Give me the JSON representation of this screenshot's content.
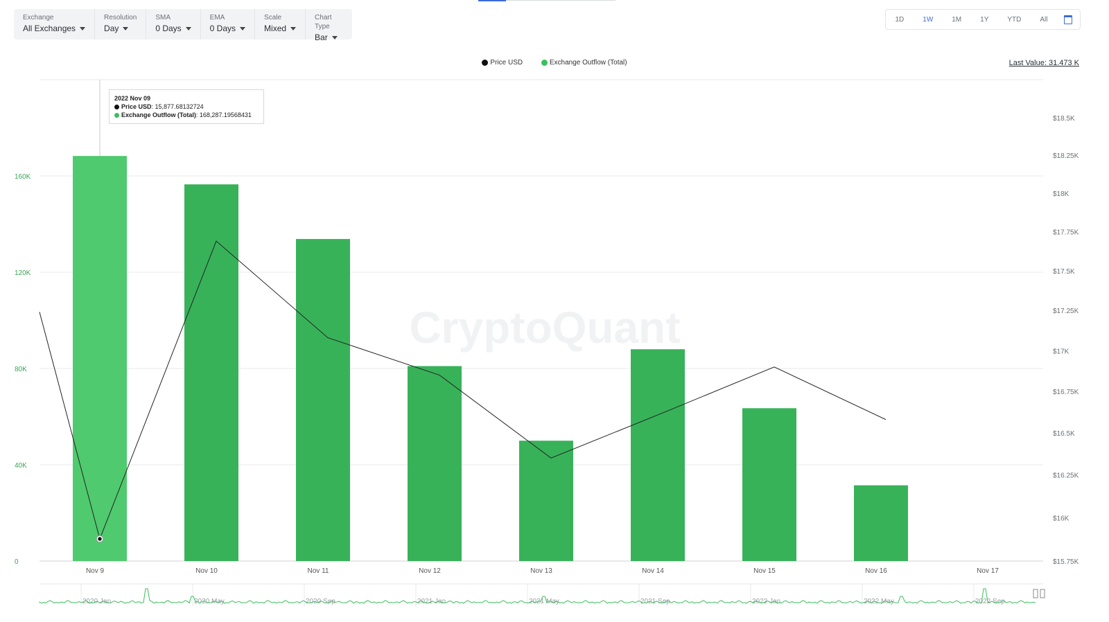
{
  "toolbar": {
    "exchange": {
      "label": "Exchange",
      "value": "All Exchanges"
    },
    "resolution": {
      "label": "Resolution",
      "value": "Day"
    },
    "sma": {
      "label": "SMA",
      "value": "0 Days"
    },
    "ema": {
      "label": "EMA",
      "value": "0 Days"
    },
    "scale": {
      "label": "Scale",
      "value": "Mixed"
    },
    "chart_type": {
      "label": "Chart Type",
      "value": "Bar"
    }
  },
  "range_buttons": [
    "1D",
    "1W",
    "1M",
    "1Y",
    "YTD",
    "All"
  ],
  "range_active": "1W",
  "legend": {
    "price": "Price USD",
    "outflow": "Exchange Outflow (Total)"
  },
  "last_value": "Last Value: 31.473 K",
  "watermark": "CryptoQuant",
  "tooltip": {
    "date": "2022 Nov 09",
    "price_label": "Price USD",
    "price_value": ": 15,877.68132724",
    "outflow_label": "Exchange Outflow (Total)",
    "outflow_value": ": 168,287.19568431"
  },
  "colors": {
    "bar": "#38b259",
    "bar_highlight": "#4fca6e",
    "line": "#222222",
    "left_axis": "#3aa655",
    "grid": "#e8e9eb"
  },
  "chart_data": {
    "type": "bar",
    "categories": [
      "Nov 9",
      "Nov 10",
      "Nov 11",
      "Nov 12",
      "Nov 13",
      "Nov 14",
      "Nov 15",
      "Nov 16",
      "Nov 17"
    ],
    "series": [
      {
        "name": "Exchange Outflow (Total)",
        "type": "bar",
        "axis": "left",
        "values": [
          168287,
          156500,
          133800,
          81000,
          50000,
          88000,
          63500,
          31473,
          null
        ]
      },
      {
        "name": "Price USD",
        "type": "line",
        "axis": "right",
        "x_start_value": 17240,
        "values": [
          15877,
          17690,
          17080,
          16850,
          16350,
          16620,
          16900,
          16580,
          null
        ]
      }
    ],
    "left_axis": {
      "ticks": [
        "0",
        "40K",
        "80K",
        "120K",
        "160K"
      ],
      "tick_values": [
        0,
        40000,
        80000,
        120000,
        160000
      ],
      "ylim": [
        0,
        200000
      ]
    },
    "right_axis": {
      "ticks": [
        "$15.75K",
        "$16K",
        "$16.25K",
        "$16.5K",
        "$16.75K",
        "$17K",
        "$17.25K",
        "$17.5K",
        "$17.75K",
        "$18K",
        "$18.25K",
        "$18.5K"
      ],
      "tick_values": [
        15750,
        16000,
        16250,
        16500,
        16750,
        17000,
        17250,
        17500,
        17750,
        18000,
        18250,
        18500
      ],
      "scale": "log"
    },
    "highlight_index": 0,
    "navigator_labels": [
      "2020 Jan",
      "2020 May",
      "2020 Sep",
      "2021 Jan",
      "2021 May",
      "2021 Sep",
      "2022 Jan",
      "2022 May",
      "2022 Sep"
    ],
    "grid": true,
    "legend_position": "top"
  }
}
